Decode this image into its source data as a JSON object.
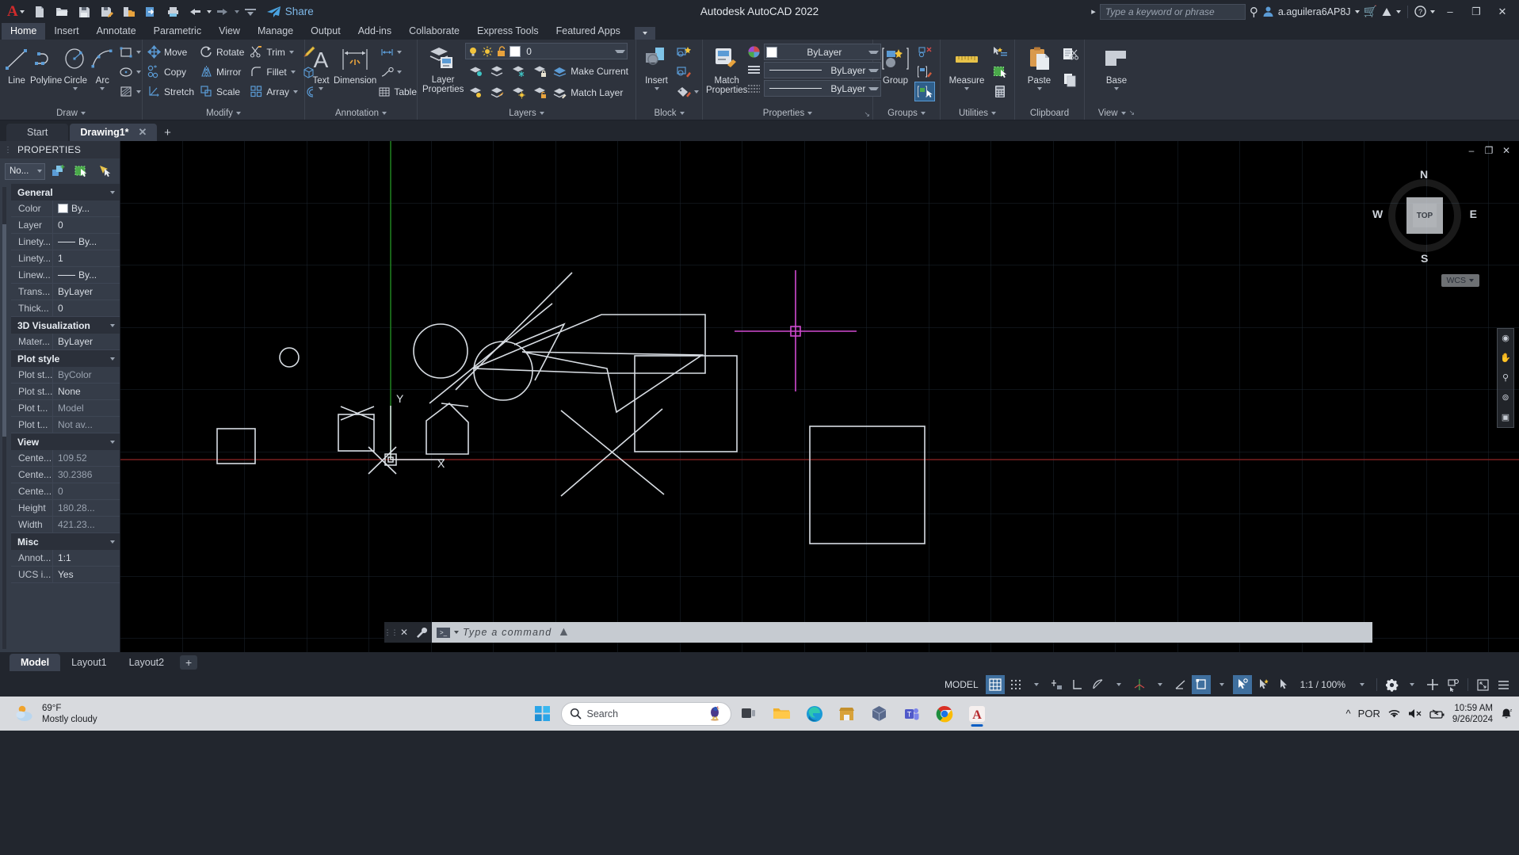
{
  "titlebar": {
    "app_title": "Autodesk AutoCAD 2022",
    "logo": "autocad-a-logo",
    "share_label": "Share",
    "search_placeholder": "Type a keyword or phrase",
    "user_name": "a.aguilera6AP8J",
    "qat": [
      {
        "name": "new-file",
        "icon": "new-document-icon"
      },
      {
        "name": "open-file",
        "icon": "open-folder-icon"
      },
      {
        "name": "save",
        "icon": "save-disk-icon"
      },
      {
        "name": "save-as",
        "icon": "save-as-icon"
      },
      {
        "name": "plot-preview",
        "icon": "device-folder-icon"
      },
      {
        "name": "export",
        "icon": "export-arrow-icon"
      },
      {
        "name": "plot",
        "icon": "printer-icon"
      },
      {
        "name": "undo",
        "icon": "undo-arrow-icon"
      },
      {
        "name": "redo",
        "icon": "redo-arrow-icon"
      }
    ],
    "window_controls": [
      "minimize",
      "restore",
      "close"
    ]
  },
  "ribbon": {
    "tabs": [
      {
        "label": "Home",
        "active": true
      },
      {
        "label": "Insert",
        "active": false
      },
      {
        "label": "Annotate",
        "active": false
      },
      {
        "label": "Parametric",
        "active": false
      },
      {
        "label": "View",
        "active": false
      },
      {
        "label": "Manage",
        "active": false
      },
      {
        "label": "Output",
        "active": false
      },
      {
        "label": "Add-ins",
        "active": false
      },
      {
        "label": "Collaborate",
        "active": false
      },
      {
        "label": "Express Tools",
        "active": false
      },
      {
        "label": "Featured Apps",
        "active": false
      }
    ],
    "panels": {
      "draw": {
        "title": "Draw",
        "buttons": [
          {
            "label": "Line",
            "icon": "line-icon"
          },
          {
            "label": "Polyline",
            "icon": "polyline-icon"
          },
          {
            "label": "Circle",
            "icon": "circle-icon"
          },
          {
            "label": "Arc",
            "icon": "arc-icon"
          }
        ],
        "small": [
          {
            "icon": "rectangle-icon"
          },
          {
            "icon": "ellipse-icon"
          },
          {
            "icon": "hatch-icon"
          }
        ]
      },
      "modify": {
        "title": "Modify",
        "items": [
          {
            "label": "Move",
            "icon": "move-icon"
          },
          {
            "label": "Rotate",
            "icon": "rotate-icon"
          },
          {
            "label": "Trim",
            "icon": "trim-icon"
          },
          {
            "label": "Copy",
            "icon": "copy-icon"
          },
          {
            "label": "Mirror",
            "icon": "mirror-icon"
          },
          {
            "label": "Fillet",
            "icon": "fillet-icon"
          },
          {
            "label": "Stretch",
            "icon": "stretch-icon"
          },
          {
            "label": "Scale",
            "icon": "scale-icon"
          },
          {
            "label": "Array",
            "icon": "array-icon"
          }
        ],
        "extras": [
          {
            "icon": "erase-brush-icon"
          },
          {
            "icon": "3d-solid-icon"
          },
          {
            "icon": "offset-icon"
          }
        ]
      },
      "annotation": {
        "title": "Annotation",
        "buttons": [
          {
            "label": "Text",
            "icon": "text-a-icon"
          },
          {
            "label": "Dimension",
            "icon": "dimension-icon"
          }
        ],
        "small": [
          {
            "icon": "linear-dim-icon"
          },
          {
            "icon": "leader-icon"
          },
          {
            "label": "Table",
            "icon": "table-icon"
          }
        ]
      },
      "layers": {
        "title": "Layers",
        "big": {
          "label": "Layer\nProperties",
          "icon": "layer-properties-icon"
        },
        "current_layer": "0",
        "layer_states": [
          {
            "icon": "lightbulb-on-icon"
          },
          {
            "icon": "sun-icon"
          },
          {
            "icon": "unlock-icon"
          }
        ],
        "row1": [
          {
            "icon": "layer-off-icon"
          },
          {
            "icon": "layer-isolate-icon"
          },
          {
            "icon": "layer-freeze-icon"
          },
          {
            "icon": "layer-lock-icon"
          }
        ],
        "row2": [
          {
            "icon": "layer-on-icon"
          },
          {
            "icon": "layer-unisolate-icon"
          },
          {
            "icon": "layer-thaw-icon"
          },
          {
            "icon": "layer-unlock-icon"
          }
        ],
        "make_current": "Make Current",
        "match_layer": "Match Layer"
      },
      "block": {
        "title": "Block",
        "big": {
          "label": "Insert",
          "icon": "insert-block-icon"
        },
        "small": [
          {
            "icon": "create-block-icon"
          },
          {
            "icon": "edit-block-icon"
          },
          {
            "icon": "define-attributes-icon"
          }
        ]
      },
      "properties": {
        "title": "Properties",
        "big": {
          "label": "Match\nProperties",
          "icon": "match-properties-icon"
        },
        "color": "ByLayer",
        "linetype": "ByLayer",
        "lineweight": "ByLayer",
        "color_swatch": "#ffffff"
      },
      "groups": {
        "title": "Groups",
        "big": {
          "label": "Group",
          "icon": "group-icon"
        },
        "small": [
          {
            "icon": "ungroup-icon"
          },
          {
            "icon": "group-edit-icon"
          },
          {
            "icon": "group-selection-toggle-icon"
          }
        ]
      },
      "utilities": {
        "title": "Utilities",
        "big": {
          "label": "Measure",
          "icon": "ruler-measure-icon"
        },
        "small": [
          {
            "icon": "quick-select-icon"
          },
          {
            "icon": "select-all-icon"
          },
          {
            "icon": "calculator-icon"
          }
        ]
      },
      "clipboard": {
        "title": "Clipboard",
        "big": {
          "label": "Paste",
          "icon": "paste-clipboard-icon"
        },
        "small": [
          {
            "icon": "cut-icon"
          },
          {
            "icon": "copy-clip-icon"
          }
        ]
      },
      "view": {
        "title": "View",
        "big": {
          "label": "Base",
          "icon": "base-view-icon"
        }
      }
    }
  },
  "doctabs": {
    "start_label": "Start",
    "tabs": [
      {
        "label": "Drawing1*",
        "active": true,
        "closable": true
      }
    ],
    "add_label": "+"
  },
  "properties_palette": {
    "title": "PROPERTIES",
    "selection": "No...",
    "tools": [
      {
        "icon": "quick-select-props-icon"
      },
      {
        "icon": "select-objects-icon"
      },
      {
        "icon": "pickadd-icon"
      }
    ],
    "groups": [
      {
        "name": "General",
        "rows": [
          {
            "key": "Color",
            "value": "By...",
            "swatch": "#ffffff",
            "dim": false
          },
          {
            "key": "Layer",
            "value": "0",
            "dim": false
          },
          {
            "key": "Linety...",
            "value": "By...",
            "line": true,
            "dim": false
          },
          {
            "key": "Linety...",
            "value": "1",
            "dim": false
          },
          {
            "key": "Linew...",
            "value": "By...",
            "line": true,
            "dim": false
          },
          {
            "key": "Trans...",
            "value": "ByLayer",
            "dim": false
          },
          {
            "key": "Thick...",
            "value": "0",
            "dim": false
          }
        ]
      },
      {
        "name": "3D Visualization",
        "rows": [
          {
            "key": "Mater...",
            "value": "ByLayer",
            "dim": false
          }
        ]
      },
      {
        "name": "Plot style",
        "rows": [
          {
            "key": "Plot st...",
            "value": "ByColor",
            "dim": true
          },
          {
            "key": "Plot st...",
            "value": "None",
            "dim": false
          },
          {
            "key": "Plot t...",
            "value": "Model",
            "dim": true
          },
          {
            "key": "Plot t...",
            "value": "Not av...",
            "dim": true
          }
        ]
      },
      {
        "name": "View",
        "rows": [
          {
            "key": "Cente...",
            "value": "109.52",
            "dim": true
          },
          {
            "key": "Cente...",
            "value": "30.2386",
            "dim": true
          },
          {
            "key": "Cente...",
            "value": "0",
            "dim": true
          },
          {
            "key": "Height",
            "value": "180.28...",
            "dim": true
          },
          {
            "key": "Width",
            "value": "421.23...",
            "dim": true
          }
        ]
      },
      {
        "name": "Misc",
        "rows": [
          {
            "key": "Annot...",
            "value": "1:1",
            "dim": false
          },
          {
            "key": "UCS i...",
            "value": "Yes",
            "dim": false
          }
        ]
      }
    ]
  },
  "canvas": {
    "viewcube": {
      "top": "TOP",
      "north": "N",
      "south": "S",
      "east": "E",
      "west": "W"
    },
    "wcs_label": "WCS",
    "ucs": {
      "x_label": "X",
      "y_label": "Y"
    },
    "window_controls": [
      "minimize",
      "restore",
      "close"
    ],
    "navbar_icons": [
      "steering-wheel-icon",
      "pan-hand-icon",
      "zoom-icon",
      "orbit-icon",
      "showmotion-icon"
    ]
  },
  "commandline": {
    "placeholder": "Type a command",
    "close_icon": "close-icon",
    "customize_icon": "wrench-icon",
    "history_icon": "console-icon"
  },
  "layouttabs": {
    "tabs": [
      {
        "label": "Model",
        "active": true
      },
      {
        "label": "Layout1",
        "active": false
      },
      {
        "label": "Layout2",
        "active": false
      }
    ],
    "add_label": "+"
  },
  "statusbar": {
    "space": "MODEL",
    "scale": "1:1 / 100%",
    "toggles": [
      {
        "name": "grid-display",
        "icon": "grid-icon",
        "on": true
      },
      {
        "name": "snap-mode",
        "icon": "snap-dots-icon",
        "on": false
      },
      {
        "name": "infer-constraints",
        "icon": "infer-icon",
        "on": false
      },
      {
        "name": "ortho-mode",
        "icon": "ortho-icon",
        "on": false
      },
      {
        "name": "polar-tracking",
        "icon": "polar-icon",
        "on": false
      },
      {
        "name": "isometric-drafting",
        "icon": "isodraft-icon",
        "on": false
      },
      {
        "name": "object-snap-tracking",
        "icon": "otrack-icon",
        "on": false
      },
      {
        "name": "object-snap",
        "icon": "osnap-icon",
        "on": true
      },
      {
        "name": "lineweight",
        "icon": "lineweight-icon",
        "on": false
      },
      {
        "name": "transparency",
        "icon": "transparency-icon",
        "on": false
      },
      {
        "name": "selection-cycling",
        "icon": "cycling-icon",
        "on": true
      },
      {
        "name": "annotation-visibility",
        "icon": "annovis-icon",
        "on": false
      },
      {
        "name": "autoscale",
        "icon": "autoscale-icon",
        "on": false
      }
    ],
    "right_icons": [
      {
        "name": "workspace-settings",
        "icon": "gear-icon"
      },
      {
        "name": "customization",
        "icon": "plus-icon"
      },
      {
        "name": "isolate-objects",
        "icon": "isolate-icon"
      },
      {
        "name": "clean-screen",
        "icon": "cleanscreen-icon"
      },
      {
        "name": "status-menu",
        "icon": "hamburger-icon"
      }
    ]
  },
  "taskbar": {
    "weather": {
      "temp": "69°F",
      "condition": "Mostly cloudy",
      "icon": "partly-cloudy-icon"
    },
    "start_icon": "windows-start-icon",
    "search_placeholder": "Search",
    "apps": [
      {
        "name": "task-view",
        "icon": "task-view-icon"
      },
      {
        "name": "file-explorer",
        "icon": "folder-icon"
      },
      {
        "name": "microsoft-edge",
        "icon": "edge-icon"
      },
      {
        "name": "store",
        "icon": "store-icon"
      },
      {
        "name": "3d-viewer",
        "icon": "cube-app-icon"
      },
      {
        "name": "teams",
        "icon": "teams-icon"
      },
      {
        "name": "chrome",
        "icon": "chrome-icon"
      },
      {
        "name": "autocad",
        "icon": "autocad-taskbar-icon",
        "active": true
      }
    ],
    "tray": {
      "overflow": "^",
      "language": "POR",
      "wifi": "wifi-icon",
      "volume": "volume-muted-icon",
      "battery": "battery-icon",
      "time": "10:59 AM",
      "date": "9/26/2024",
      "notifications": "bell-icon"
    }
  }
}
